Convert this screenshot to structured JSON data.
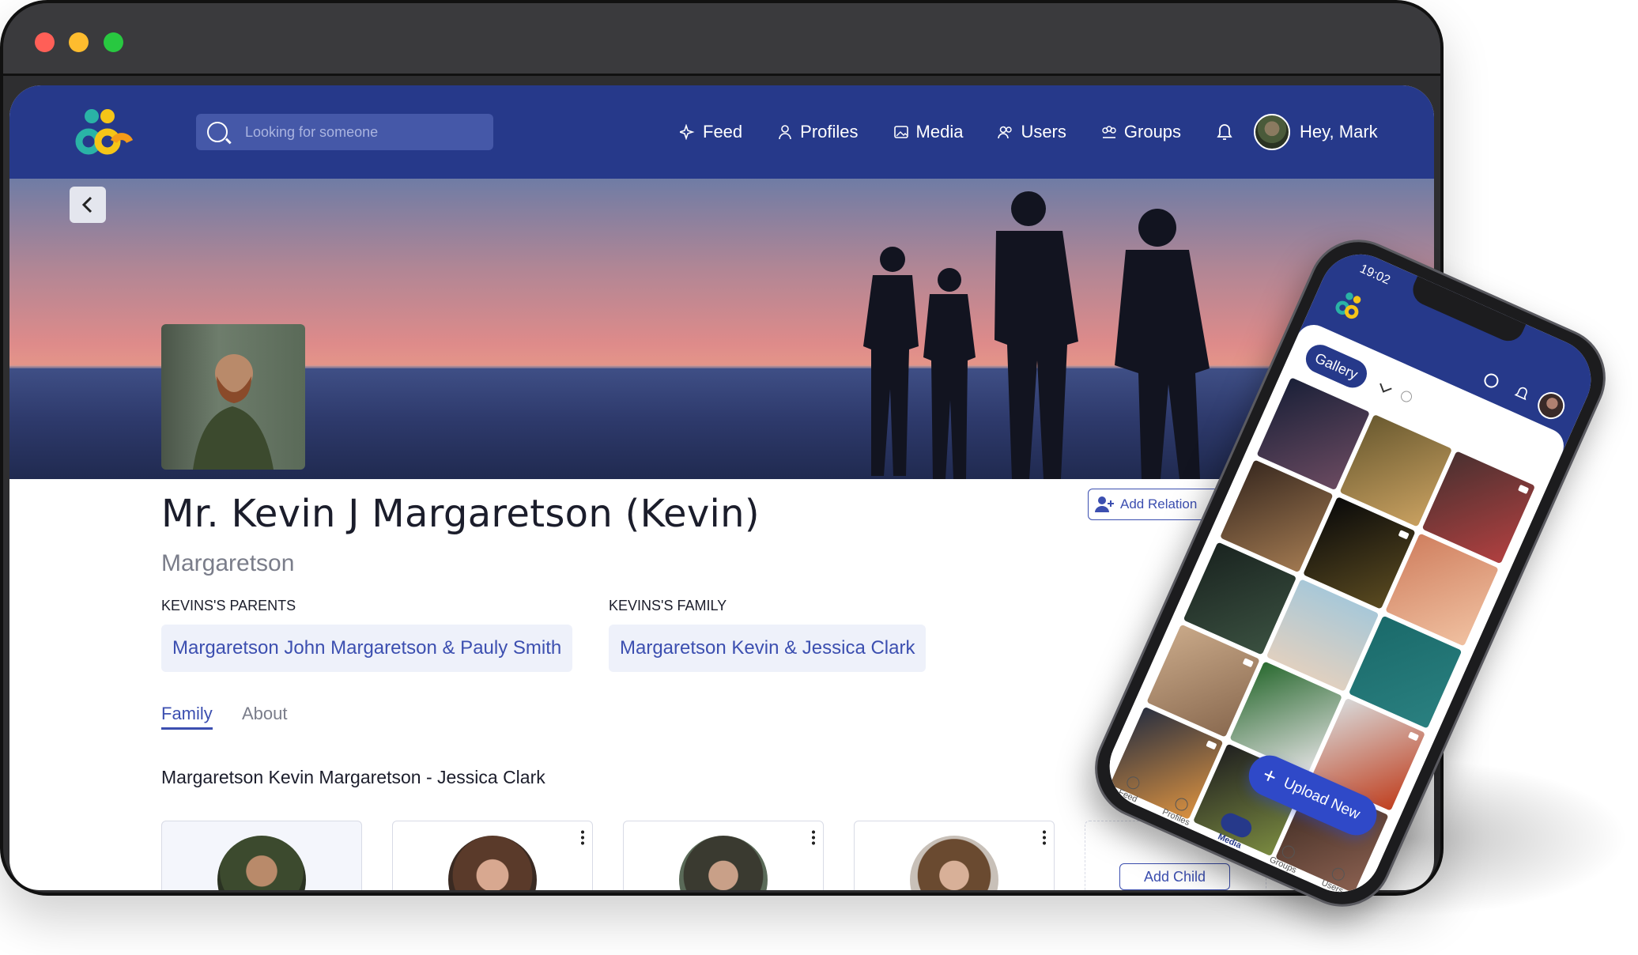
{
  "browser": {
    "search_placeholder": "Looking for someone",
    "nav": [
      {
        "label": "Feed",
        "icon": "sparkle-icon"
      },
      {
        "label": "Profiles",
        "icon": "person-icon"
      },
      {
        "label": "Media",
        "icon": "image-icon"
      },
      {
        "label": "Users",
        "icon": "users-icon"
      },
      {
        "label": "Groups",
        "icon": "groups-icon"
      }
    ],
    "greeting": "Hey, Mark"
  },
  "profile": {
    "full_name": "Mr. Kevin J Margaretson (Kevin)",
    "surname": "Margaretson",
    "parents_label": "KEVINS'S PARENTS",
    "parents_value": "Margaretson John Margaretson & Pauly Smith",
    "family_label": "KEVINS'S FAMILY",
    "family_value": "Margaretson Kevin & Jessica Clark",
    "add_relation_label": "Add Relation",
    "tabs": [
      "Family",
      "About"
    ],
    "couple_title": "Margaretson Kevin Margaretson - Jessica Clark",
    "add_child_label": "Add Child"
  },
  "phone": {
    "time": "19:02",
    "gallery_label": "Gallery",
    "upload_label": "Upload New",
    "tabs": [
      "Feed",
      "Profiles",
      "Media",
      "Groups",
      "Users"
    ],
    "active_tab": "Media"
  },
  "colors": {
    "brand": "#26398a",
    "accent": "#3c4fb0"
  }
}
